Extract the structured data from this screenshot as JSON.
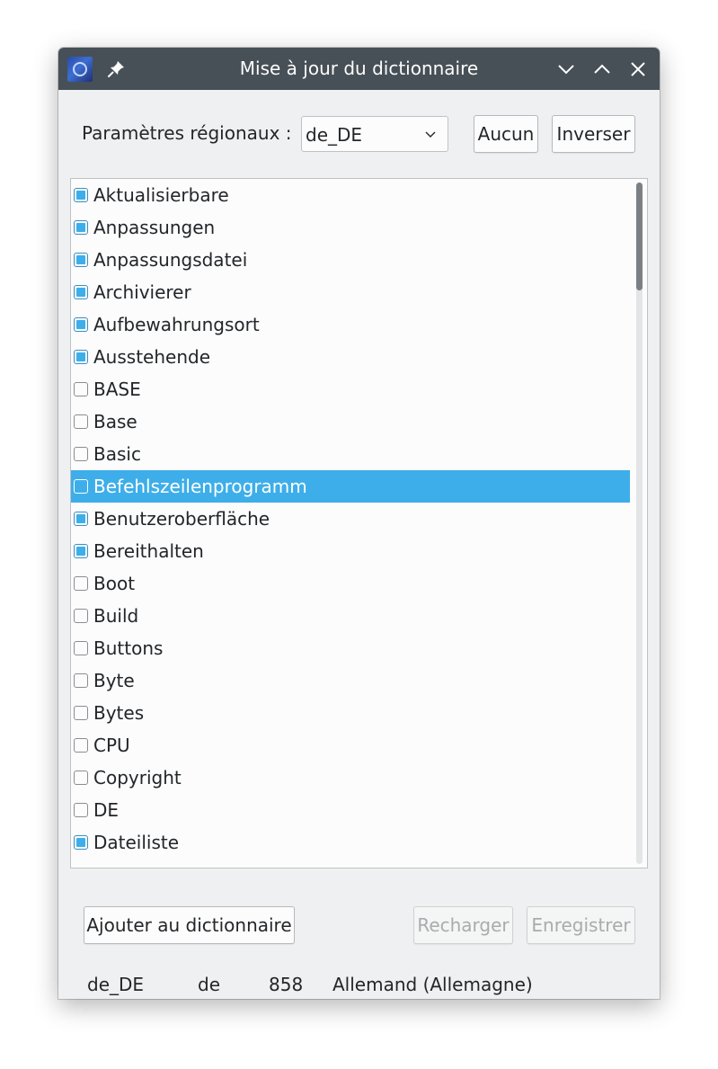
{
  "window": {
    "title": "Mise à jour du dictionnaire",
    "icons": {
      "app": "app-icon",
      "pin": "pin-icon",
      "minimize": "chevron-down-icon",
      "maximize": "chevron-up-icon",
      "close": "close-icon"
    }
  },
  "locale": {
    "label": "Paramètres régionaux :",
    "selected": "de_DE"
  },
  "buttons": {
    "none": "Aucun",
    "invert": "Inverser",
    "add": "Ajouter au dictionnaire",
    "reload": "Recharger",
    "save": "Enregistrer"
  },
  "list": {
    "items": [
      {
        "label": "Aktualisierbare",
        "checked": true,
        "selected": false
      },
      {
        "label": "Anpassungen",
        "checked": true,
        "selected": false
      },
      {
        "label": "Anpassungsdatei",
        "checked": true,
        "selected": false
      },
      {
        "label": "Archivierer",
        "checked": true,
        "selected": false
      },
      {
        "label": "Aufbewahrungsort",
        "checked": true,
        "selected": false
      },
      {
        "label": "Ausstehende",
        "checked": true,
        "selected": false
      },
      {
        "label": "BASE",
        "checked": false,
        "selected": false
      },
      {
        "label": "Base",
        "checked": false,
        "selected": false
      },
      {
        "label": "Basic",
        "checked": false,
        "selected": false
      },
      {
        "label": "Befehlszeilenprogramm",
        "checked": false,
        "selected": true
      },
      {
        "label": "Benutzeroberfläche",
        "checked": true,
        "selected": false
      },
      {
        "label": "Bereithalten",
        "checked": true,
        "selected": false
      },
      {
        "label": "Boot",
        "checked": false,
        "selected": false
      },
      {
        "label": "Build",
        "checked": false,
        "selected": false
      },
      {
        "label": "Buttons",
        "checked": false,
        "selected": false
      },
      {
        "label": "Byte",
        "checked": false,
        "selected": false
      },
      {
        "label": "Bytes",
        "checked": false,
        "selected": false
      },
      {
        "label": "CPU",
        "checked": false,
        "selected": false
      },
      {
        "label": "Copyright",
        "checked": false,
        "selected": false
      },
      {
        "label": "DE",
        "checked": false,
        "selected": false
      },
      {
        "label": "Dateiliste",
        "checked": true,
        "selected": false
      }
    ]
  },
  "status": {
    "locale": "de_DE",
    "language_code": "de",
    "word_count": "858",
    "language_name": "Allemand (Allemagne)"
  }
}
